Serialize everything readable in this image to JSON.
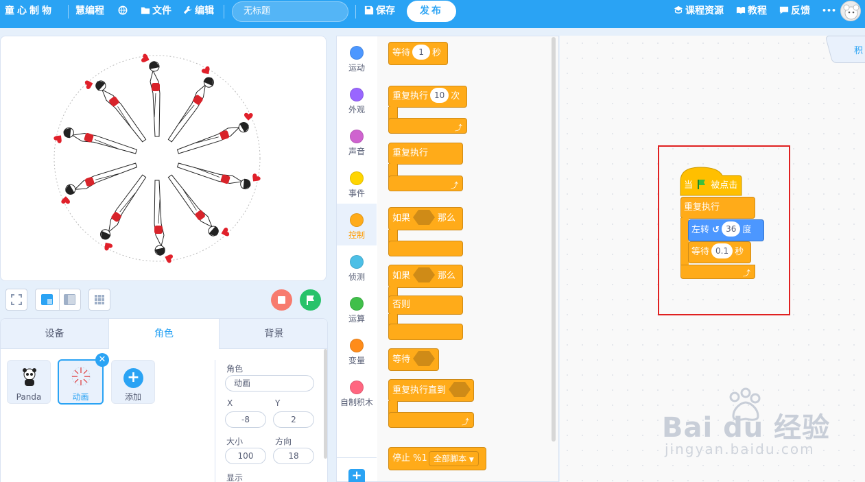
{
  "topbar": {
    "logo": "童心制物",
    "product": "慧编程",
    "file": "文件",
    "edit": "编辑",
    "title_value": "无标题",
    "save": "保存",
    "publish": "发布",
    "course": "课程资源",
    "tutorial": "教程",
    "feedback": "反馈",
    "more": "•••"
  },
  "stage_controls": {
    "stop": "stop-icon",
    "go": "green-flag-icon"
  },
  "sprite_panel": {
    "tabs": [
      "设备",
      "角色",
      "背景"
    ],
    "active_tab": "角色",
    "sprites": [
      "Panda",
      "动画"
    ],
    "add": "添加",
    "props": {
      "role_label": "角色",
      "role_value": "动画",
      "x_label": "X",
      "x_value": "-8",
      "y_label": "Y",
      "y_value": "2",
      "size_label": "大小",
      "size_value": "100",
      "dir_label": "方向",
      "dir_value": "18",
      "show_label": "显示"
    }
  },
  "categories": [
    {
      "label": "运动",
      "color": "#4c97ff"
    },
    {
      "label": "外观",
      "color": "#9966ff"
    },
    {
      "label": "声音",
      "color": "#cf63cf"
    },
    {
      "label": "事件",
      "color": "#ffd500"
    },
    {
      "label": "控制",
      "color": "#ffab19"
    },
    {
      "label": "侦测",
      "color": "#4cbfe6"
    },
    {
      "label": "运算",
      "color": "#40bf4a"
    },
    {
      "label": "变量",
      "color": "#ff8c1a"
    },
    {
      "label": "自制积木",
      "color": "#ff6680"
    }
  ],
  "selected_category": "控制",
  "palette": {
    "wait": "等待",
    "wait_val": "1",
    "seconds": "秒",
    "repeat": "重复执行",
    "repeat_val": "10",
    "times": "次",
    "forever": "重复执行",
    "if": "如果",
    "then": "那么",
    "if2": "如果",
    "then2": "那么",
    "else": "否则",
    "wait_until": "等待",
    "repeat_until": "重复执行直到",
    "stop": "停止 %1",
    "stop_opt": "全部脚本"
  },
  "script": {
    "when": "当",
    "clicked": "被点击",
    "forever": "重复执行",
    "turn": "左转",
    "turn_val": "36",
    "degrees": "度",
    "wait": "等待",
    "wait_val": "0.1",
    "seconds": "秒"
  },
  "right_tab": "积",
  "watermark": {
    "brand": "Bai du 经验",
    "url": "jingyan.baidu.com"
  },
  "colors": {
    "accent": "#2aa3f4",
    "control": "#ffab19",
    "events": "#ffbf00",
    "motion": "#4c97ff",
    "highlight": "#e02020"
  }
}
